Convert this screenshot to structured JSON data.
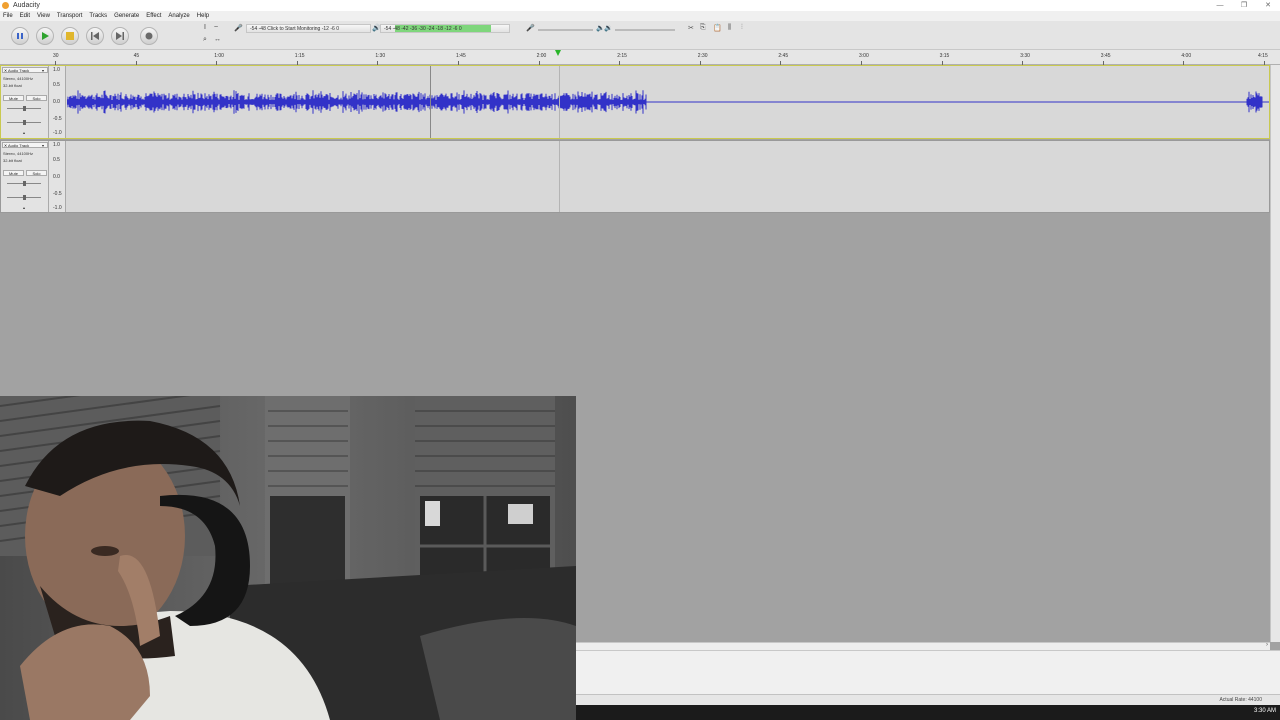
{
  "window": {
    "title": "Audacity",
    "controls": [
      "—",
      "❐",
      "✕"
    ]
  },
  "menu": [
    "File",
    "Edit",
    "View",
    "Transport",
    "Tracks",
    "Generate",
    "Effect",
    "Analyze",
    "Help"
  ],
  "meters": {
    "record_label": "Click to Start Monitoring",
    "record_scale": [
      "-54",
      "-48",
      "-12",
      "-6",
      "0"
    ],
    "play_scale": [
      "-54",
      "-48",
      "-42",
      "-36",
      "-30",
      "-24",
      "-18",
      "-12",
      "-6",
      "0"
    ]
  },
  "ruler": {
    "labels": [
      "30",
      "45",
      "1:00",
      "1:15",
      "1:30",
      "1:45",
      "2:00",
      "2:15",
      "2:30",
      "2:45",
      "3:00",
      "3:15",
      "3:30",
      "3:45",
      "4:00",
      "4:15"
    ]
  },
  "tracks": [
    {
      "name": "Audio Track",
      "info1": "Stereo, 44100Hz",
      "info2": "32-bit float",
      "mute": "Mute",
      "solo": "Solo",
      "scale": [
        "1.0",
        "0.5",
        "0.0",
        "-0.5",
        "-1.0"
      ]
    },
    {
      "name": "Audio Track",
      "info1": "Stereo, 44100Hz",
      "info2": "32-bit float",
      "mute": "Mute",
      "solo": "Solo",
      "scale": [
        "1.0",
        "0.5",
        "0.0",
        "-0.5",
        "-1.0"
      ]
    }
  ],
  "status": {
    "rate": "Actual Rate: 44100"
  },
  "taskbar": {
    "clock": "3:30 AM"
  },
  "colors": {
    "waveform": "#3232c8",
    "selected_border": "#c9c94f",
    "meter_green": "#7fd67c"
  }
}
